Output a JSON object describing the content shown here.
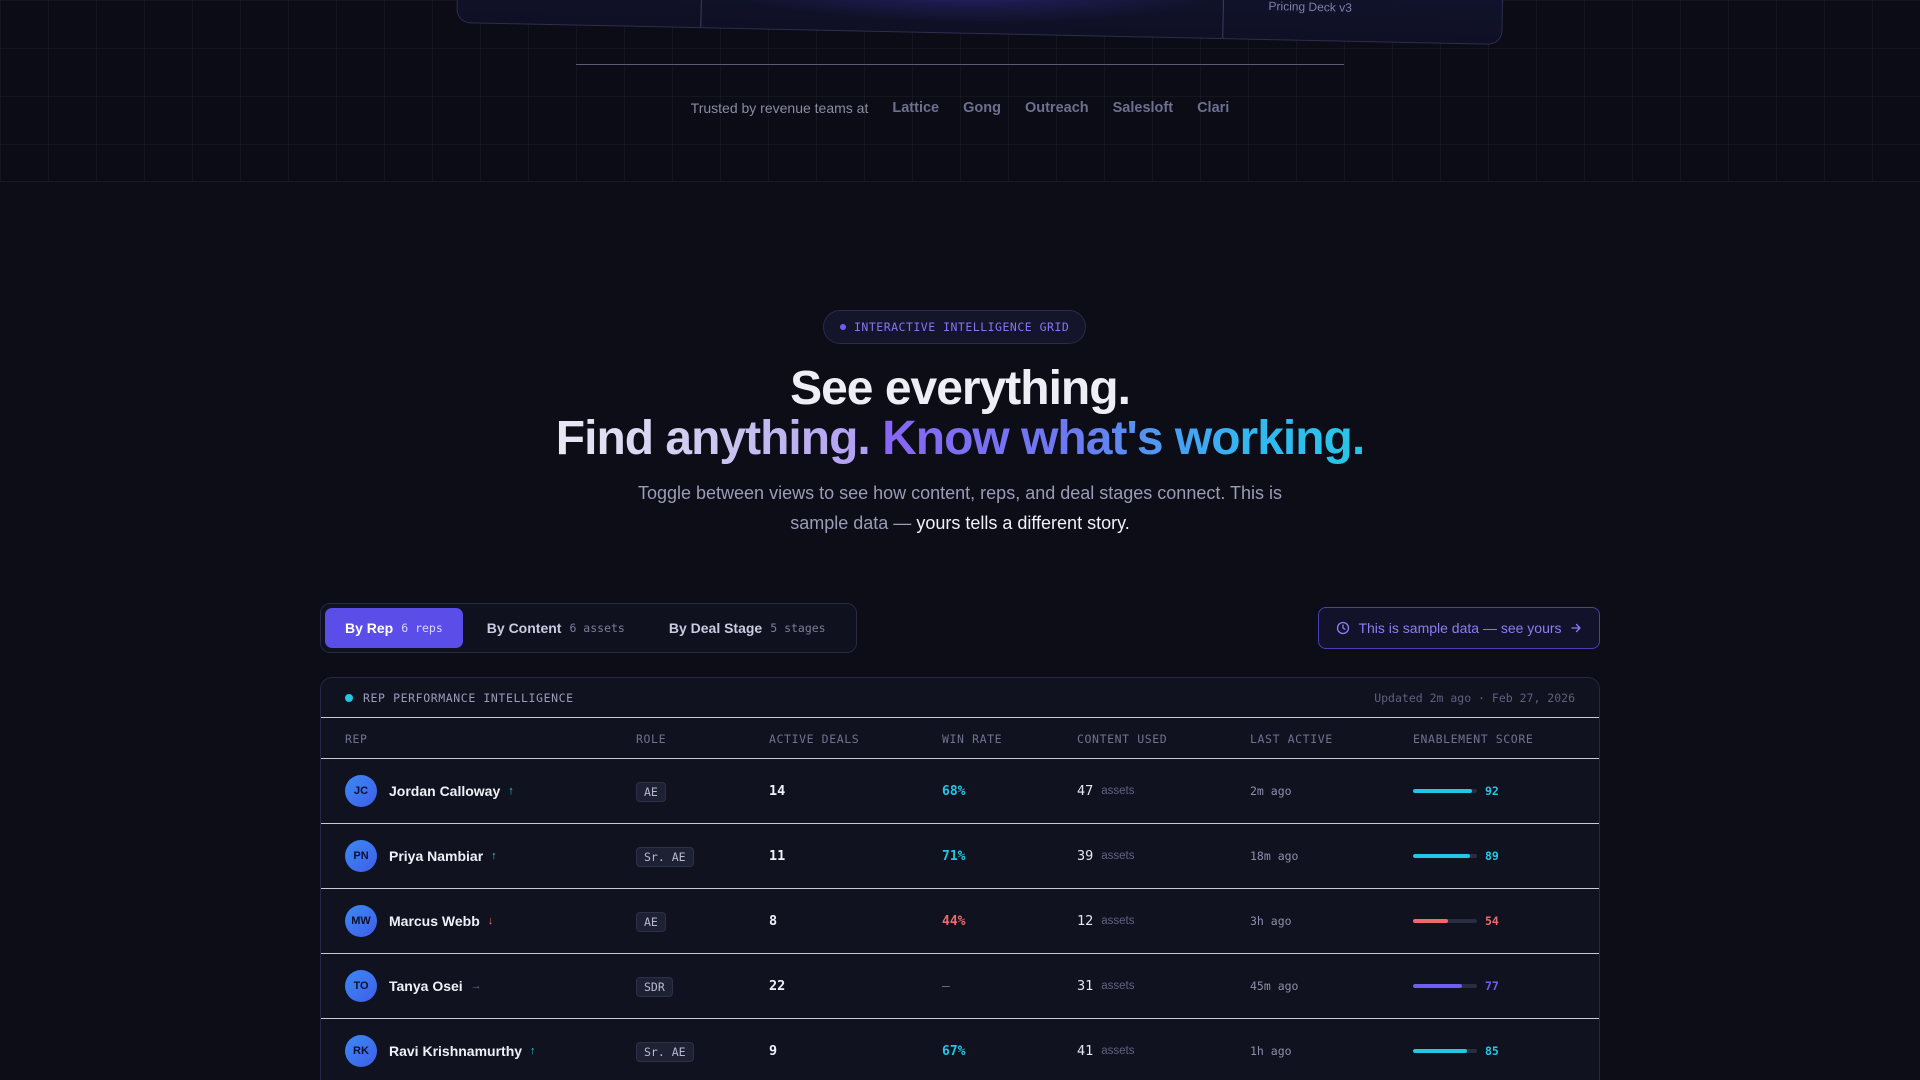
{
  "hero_preview": {
    "caption": "Pricing Deck v3"
  },
  "trusted": {
    "label": "Trusted by revenue teams at",
    "logos": [
      "Lattice",
      "Gong",
      "Outreach",
      "Salesloft",
      "Clari"
    ]
  },
  "section": {
    "eyebrow": "INTERACTIVE INTELLIGENCE GRID",
    "headline_line1": "See everything.",
    "headline_line2_a": "Find anything.",
    "headline_line2_b": "Know what's working.",
    "subtext_a": "Toggle between views to see how content, reps, and deal stages connect. This is sample data —",
    "subtext_b": "yours tells a different story."
  },
  "tabs": [
    {
      "label": "By Rep",
      "count": "6 reps",
      "active": true
    },
    {
      "label": "By Content",
      "count": "6 assets",
      "active": false
    },
    {
      "label": "By Deal Stage",
      "count": "5 stages",
      "active": false
    }
  ],
  "sample_button": {
    "label": "This is sample data — see yours"
  },
  "panel": {
    "title": "REP PERFORMANCE INTELLIGENCE",
    "updated": "Updated 2m ago · Feb 27, 2026",
    "columns": {
      "rep": "REP",
      "role": "ROLE",
      "deals": "ACTIVE DEALS",
      "win": "WIN RATE",
      "content": "CONTENT USED",
      "last": "LAST ACTIVE",
      "score": "ENABLEMENT SCORE"
    },
    "content_unit": "assets",
    "rows": [
      {
        "initials": "JC",
        "name": "Jordan Calloway",
        "trend": "↑",
        "trend_type": "up",
        "role": "AE",
        "deals": "14",
        "win_rate": "68%",
        "win_type": "good",
        "content": "47",
        "last_active": "2m ago",
        "score": "92",
        "score_fraction": 0.92,
        "score_color": "#22c7e6"
      },
      {
        "initials": "PN",
        "name": "Priya Nambiar",
        "trend": "↑",
        "trend_type": "up",
        "role": "Sr. AE",
        "deals": "11",
        "win_rate": "71%",
        "win_type": "good",
        "content": "39",
        "last_active": "18m ago",
        "score": "89",
        "score_fraction": 0.89,
        "score_color": "#22c7e6"
      },
      {
        "initials": "MW",
        "name": "Marcus Webb",
        "trend": "↓",
        "trend_type": "down",
        "role": "AE",
        "deals": "8",
        "win_rate": "44%",
        "win_type": "bad",
        "content": "12",
        "last_active": "3h ago",
        "score": "54",
        "score_fraction": 0.54,
        "score_color": "#ef6a6a"
      },
      {
        "initials": "TO",
        "name": "Tanya Osei",
        "trend": "→",
        "trend_type": "flat",
        "role": "SDR",
        "deals": "22",
        "win_rate": "—",
        "win_type": "none",
        "content": "31",
        "last_active": "45m ago",
        "score": "77",
        "score_fraction": 0.77,
        "score_color": "#6f5ff0"
      },
      {
        "initials": "RK",
        "name": "Ravi Krishnamurthy",
        "trend": "↑",
        "trend_type": "up",
        "role": "Sr. AE",
        "deals": "9",
        "win_rate": "67%",
        "win_type": "good",
        "content": "41",
        "last_active": "1h ago",
        "score": "85",
        "score_fraction": 0.85,
        "score_color": "#22c7e6"
      }
    ]
  }
}
